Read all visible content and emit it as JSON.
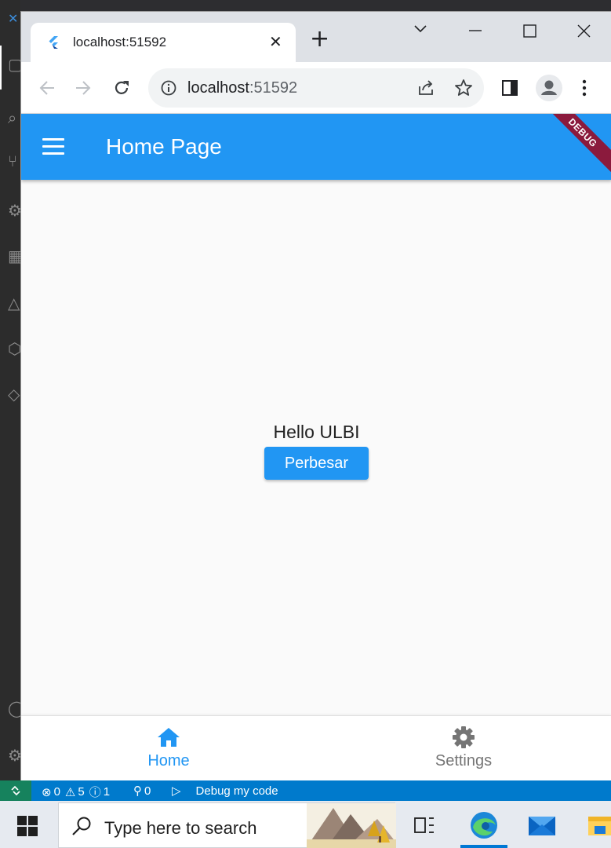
{
  "browser": {
    "tab_title": "localhost:51592",
    "url_host": "localhost",
    "url_port": ":51592"
  },
  "app": {
    "title": "Home Page",
    "debug_banner": "DEBUG",
    "greeting": "Hello ULBI",
    "button_label": "Perbesar",
    "bottom_nav": [
      {
        "label": "Home",
        "icon": "home-icon",
        "active": true
      },
      {
        "label": "Settings",
        "icon": "gear-icon",
        "active": false
      }
    ],
    "colors": {
      "primary": "#2196f3",
      "inactive": "#757575"
    }
  },
  "statusbar": {
    "errors": "0",
    "warnings": "5",
    "info": "1",
    "ports": "0",
    "debug_label": "Debug my code"
  },
  "taskbar": {
    "search_placeholder": "Type here to search"
  }
}
